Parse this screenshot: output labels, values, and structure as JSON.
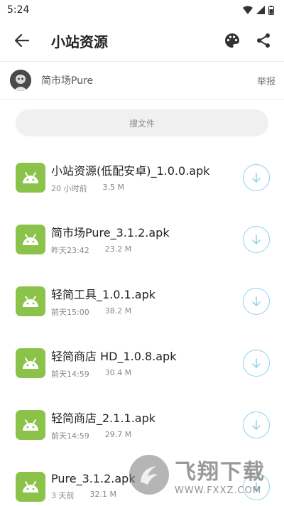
{
  "status_bar": {
    "time": "5:24"
  },
  "app_bar": {
    "title": "小站资源"
  },
  "uploader": {
    "name": "简市场Pure",
    "report_label": "举报"
  },
  "search": {
    "placeholder": "搜文件"
  },
  "files": [
    {
      "name": "小站资源(低配安卓)_1.0.0.apk",
      "time": "20 小时前",
      "size": "3.5 M"
    },
    {
      "name": "简市场Pure_3.1.2.apk",
      "time": "昨天23:42",
      "size": "23.2 M"
    },
    {
      "name": "轻简工具_1.0.1.apk",
      "time": "前天15:00",
      "size": "38.2 M"
    },
    {
      "name": "轻简商店 HD_1.0.8.apk",
      "time": "前天14:59",
      "size": "30.4 M"
    },
    {
      "name": "轻简商店_2.1.1.apk",
      "time": "前天14:59",
      "size": "29.7 M"
    },
    {
      "name": "Pure_3.1.2.apk",
      "time": "3 天前",
      "size": "32.1 M"
    }
  ],
  "watermark": {
    "text": "飞翔下载",
    "url": "WWW.FXXZ.COM"
  },
  "colors": {
    "apk_icon": "#8bc34a",
    "download_ring": "#8ed1ec",
    "search_bg": "#f0f0f0"
  }
}
